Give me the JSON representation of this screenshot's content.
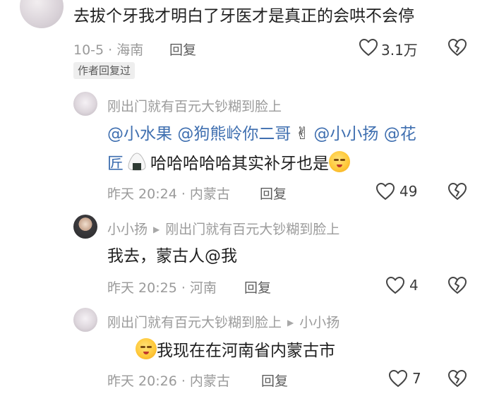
{
  "top_comment": {
    "text": "去拔个牙我才明白了牙医才是真正的会哄不会停",
    "date_location": "10-5 · 海南",
    "reply_label": "回复",
    "likes": "3.1万",
    "author_badge": "作者回复过"
  },
  "reply1": {
    "author": "刚出门就有百元大钞糊到脸上",
    "mentions": [
      "@小水果",
      "@狗熊岭你二哥",
      "@小小扬",
      "@花"
    ],
    "line2_mention": "匠",
    "text": "哈哈哈哈哈其实补牙也是",
    "date_location": "昨天 20:24 · 内蒙古",
    "reply_label": "回复",
    "likes": "49"
  },
  "reply2": {
    "author": "小小扬",
    "reply_to": "刚出门就有百元大钞糊到脸上",
    "text": "我去，蒙古人@我",
    "date_location": "昨天 20:25 · 河南",
    "reply_label": "回复",
    "likes": "4"
  },
  "reply3": {
    "author": "刚出门就有百元大钞糊到脸上",
    "reply_to": "小小扬",
    "text": "我现在在河南省内蒙古市",
    "date_location": "昨天 20:26 · 内蒙古",
    "reply_label": "回复",
    "likes": "7"
  },
  "icons": {
    "like": "heart-outline-icon",
    "dislike": "broken-heart-icon",
    "emoji_pain": "wincing-face-emoji",
    "emoji_victory": "victory-hand-emoji",
    "emoji_onigiri": "rice-ball-emoji"
  }
}
